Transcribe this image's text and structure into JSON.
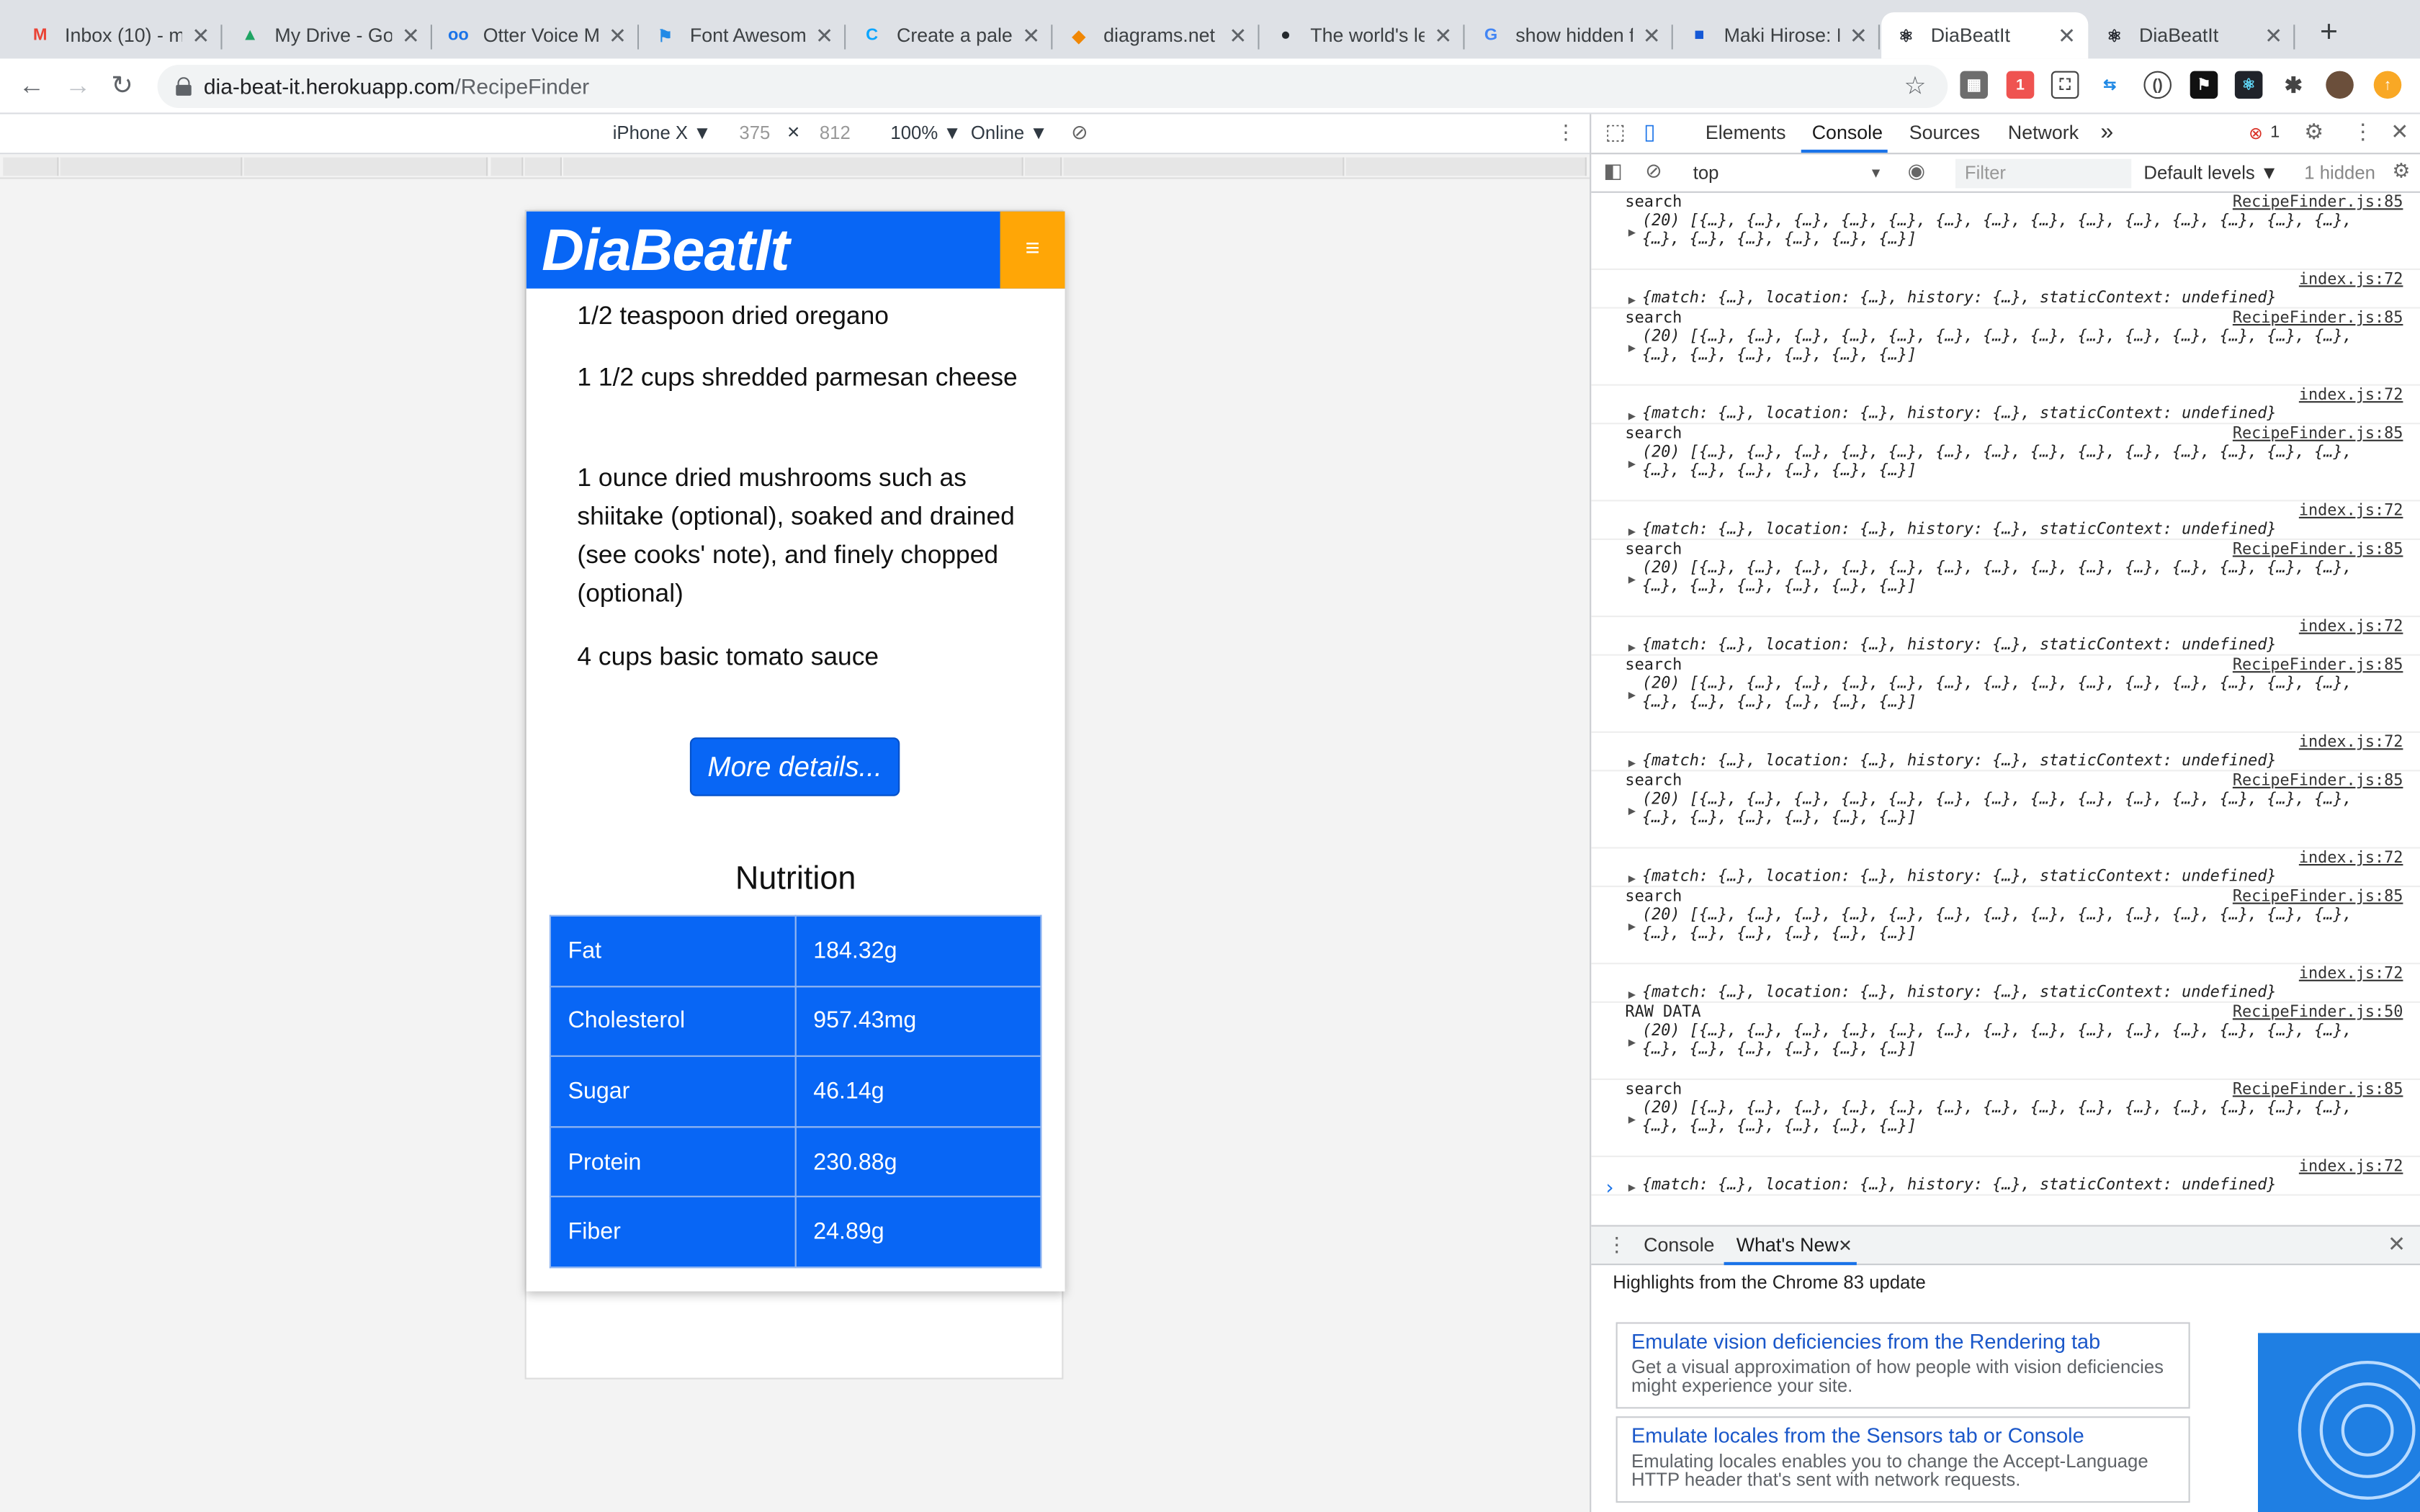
{
  "browser": {
    "tabs": [
      {
        "title": "Inbox (10) - m",
        "icon": "gmail-icon",
        "color": "#ea4335",
        "glyph": "M"
      },
      {
        "title": "My Drive - Go",
        "icon": "drive-icon",
        "color": "#1fa463",
        "glyph": "▲"
      },
      {
        "title": "Otter Voice Me",
        "icon": "otter-icon",
        "color": "#1a73e8",
        "glyph": "oo"
      },
      {
        "title": "Font Awesome",
        "icon": "flag-icon",
        "color": "#228ae6",
        "glyph": "⚑"
      },
      {
        "title": "Create a palet",
        "icon": "coolors-icon",
        "color": "#0aa5ff",
        "glyph": "C"
      },
      {
        "title": "diagrams.net",
        "icon": "diagrams-icon",
        "color": "#f08705",
        "glyph": "◆"
      },
      {
        "title": "The world's le",
        "icon": "github-icon",
        "color": "#24292e",
        "glyph": "●"
      },
      {
        "title": "show hidden f",
        "icon": "google-icon",
        "color": "#4285f4",
        "glyph": "G"
      },
      {
        "title": "Maki Hirose: L",
        "icon": "bookmark-icon",
        "color": "#1558d6",
        "glyph": "■"
      },
      {
        "title": "DiaBeatIt",
        "icon": "react-icon",
        "color": "#20232a",
        "glyph": "⚛",
        "active": true
      },
      {
        "title": "DiaBeatIt",
        "icon": "react-icon",
        "color": "#20232a",
        "glyph": "⚛"
      }
    ],
    "url_host": "dia-beat-it.herokuapp.com",
    "url_path": "/RecipeFinder"
  },
  "device_toolbar": {
    "device": "iPhone X ▼",
    "width": "375",
    "times": "×",
    "height": "812",
    "zoom": "100% ▼",
    "network": "Online ▼"
  },
  "app": {
    "brand": "DiaBeatIt",
    "ingredients": [
      "1/2 teaspoon dried oregano",
      "1 1/2 cups shredded parmesan cheese",
      "1 ounce dried mushrooms such as shiitake (optional), soaked and drained (see cooks' note), and finely chopped (optional)",
      "4 cups basic tomato sauce"
    ],
    "more_button": "More details...",
    "nutrition_title": "Nutrition",
    "nutrition": [
      {
        "name": "Fat",
        "value": "184.32g"
      },
      {
        "name": "Cholesterol",
        "value": "957.43mg"
      },
      {
        "name": "Sugar",
        "value": "46.14g"
      },
      {
        "name": "Protein",
        "value": "230.88g"
      },
      {
        "name": "Fiber",
        "value": "24.89g"
      }
    ]
  },
  "devtools": {
    "tabs": [
      "Elements",
      "Console",
      "Sources",
      "Network"
    ],
    "more": "»",
    "error_count": "1",
    "context": "top",
    "filter_placeholder": "Filter",
    "levels": "Default levels ▼",
    "hidden": "1 hidden",
    "console": [
      {
        "label": "search",
        "src": "RecipeFinder.js:85",
        "body": "(20) [{…}, {…}, {…}, {…}, {…}, {…}, {…}, {…}, {…}, {…}, {…}, {…}, {…}, {…},\n{…}, {…}, {…}, {…}, {…}, {…}]"
      },
      {
        "label": "",
        "src": "index.js:72",
        "body": "{match: {…}, location: {…}, history: {…}, staticContext: undefined}"
      },
      {
        "label": "search",
        "src": "RecipeFinder.js:85",
        "body": "(20) [{…}, {…}, {…}, {…}, {…}, {…}, {…}, {…}, {…}, {…}, {…}, {…}, {…}, {…},\n{…}, {…}, {…}, {…}, {…}, {…}]"
      },
      {
        "label": "",
        "src": "index.js:72",
        "body": "{match: {…}, location: {…}, history: {…}, staticContext: undefined}"
      },
      {
        "label": "search",
        "src": "RecipeFinder.js:85",
        "body": "(20) [{…}, {…}, {…}, {…}, {…}, {…}, {…}, {…}, {…}, {…}, {…}, {…}, {…}, {…},\n{…}, {…}, {…}, {…}, {…}, {…}]"
      },
      {
        "label": "",
        "src": "index.js:72",
        "body": "{match: {…}, location: {…}, history: {…}, staticContext: undefined}"
      },
      {
        "label": "search",
        "src": "RecipeFinder.js:85",
        "body": "(20) [{…}, {…}, {…}, {…}, {…}, {…}, {…}, {…}, {…}, {…}, {…}, {…}, {…}, {…},\n{…}, {…}, {…}, {…}, {…}, {…}]"
      },
      {
        "label": "",
        "src": "index.js:72",
        "body": "{match: {…}, location: {…}, history: {…}, staticContext: undefined}"
      },
      {
        "label": "search",
        "src": "RecipeFinder.js:85",
        "body": "(20) [{…}, {…}, {…}, {…}, {…}, {…}, {…}, {…}, {…}, {…}, {…}, {…}, {…}, {…},\n{…}, {…}, {…}, {…}, {…}, {…}]"
      },
      {
        "label": "",
        "src": "index.js:72",
        "body": "{match: {…}, location: {…}, history: {…}, staticContext: undefined}"
      },
      {
        "label": "search",
        "src": "RecipeFinder.js:85",
        "body": "(20) [{…}, {…}, {…}, {…}, {…}, {…}, {…}, {…}, {…}, {…}, {…}, {…}, {…}, {…},\n{…}, {…}, {…}, {…}, {…}, {…}]"
      },
      {
        "label": "",
        "src": "index.js:72",
        "body": "{match: {…}, location: {…}, history: {…}, staticContext: undefined}"
      },
      {
        "label": "search",
        "src": "RecipeFinder.js:85",
        "body": "(20) [{…}, {…}, {…}, {…}, {…}, {…}, {…}, {…}, {…}, {…}, {…}, {…}, {…}, {…},\n{…}, {…}, {…}, {…}, {…}, {…}]"
      },
      {
        "label": "",
        "src": "index.js:72",
        "body": "{match: {…}, location: {…}, history: {…}, staticContext: undefined}"
      },
      {
        "label": "RAW DATA",
        "src": "RecipeFinder.js:50",
        "body": "(20) [{…}, {…}, {…}, {…}, {…}, {…}, {…}, {…}, {…}, {…}, {…}, {…}, {…}, {…},\n{…}, {…}, {…}, {…}, {…}, {…}]"
      },
      {
        "label": "search",
        "src": "RecipeFinder.js:85",
        "body": "(20) [{…}, {…}, {…}, {…}, {…}, {…}, {…}, {…}, {…}, {…}, {…}, {…}, {…}, {…},\n{…}, {…}, {…}, {…}, {…}, {…}]"
      },
      {
        "label": "",
        "src": "index.js:72",
        "body": "{match: {…}, location: {…}, history: {…}, staticContext: undefined}"
      }
    ],
    "prompt": "›",
    "drawer_tabs": [
      "Console",
      "What's New"
    ],
    "whats_new_heading": "Highlights from the Chrome 83 update",
    "whats_new_items": [
      {
        "title": "Emulate vision deficiencies from the Rendering tab",
        "desc": "Get a visual approximation of how people with vision deficiencies might experience your site."
      },
      {
        "title": "Emulate locales from the Sensors tab or Console",
        "desc": "Emulating locales enables you to change the Accept-Language HTTP header that's sent with network requests."
      }
    ]
  }
}
